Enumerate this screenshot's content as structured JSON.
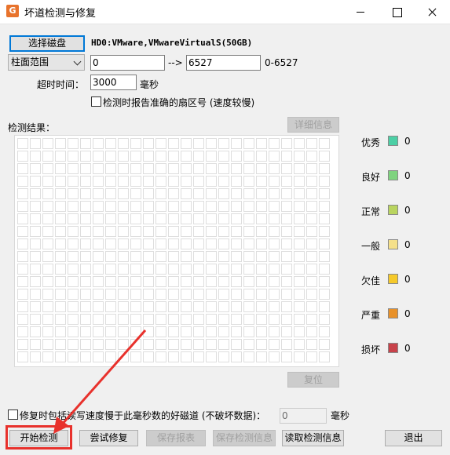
{
  "window": {
    "title": "坏道检测与修复",
    "app_icon_glyph": "G"
  },
  "disk": {
    "select_button": "选择磁盘",
    "name": "HD0:VMware,VMwareVirtualS(50GB)"
  },
  "range": {
    "mode": "柱面范围",
    "start": "0",
    "arrow": "-->",
    "end": "6527",
    "max_label": "0-6527"
  },
  "timeout": {
    "label": "超时时间：",
    "value": "3000",
    "unit": "毫秒"
  },
  "options": {
    "report_exact_sector": "检测时报告准确的扇区号 (速度较慢)",
    "repair_slow_label": "修复时包括读写速度慢于此毫秒数的好磁道 (不破坏数据)：",
    "repair_slow_value": "0",
    "repair_slow_unit": "毫秒"
  },
  "results": {
    "label": "检测结果：",
    "details_button": "详细信息",
    "reset_button": "复位",
    "grid_columns": 25,
    "grid_rows": 18
  },
  "legend": [
    {
      "label": "优秀",
      "color": "#4ccfa5",
      "count": "0"
    },
    {
      "label": "良好",
      "color": "#7ed37e",
      "count": "0"
    },
    {
      "label": "正常",
      "color": "#b9d45f",
      "count": "0"
    },
    {
      "label": "一般",
      "color": "#f5e08a",
      "count": "0"
    },
    {
      "label": "欠佳",
      "color": "#f5c92a",
      "count": "0"
    },
    {
      "label": "严重",
      "color": "#e8912a",
      "count": "0"
    },
    {
      "label": "损坏",
      "color": "#c8424a",
      "count": "0"
    }
  ],
  "actions": {
    "start": "开始检测",
    "try_repair": "尝试修复",
    "save_report": "保存报表",
    "save_info": "保存检测信息",
    "load_info": "读取检测信息",
    "exit": "退出"
  },
  "annotation": {
    "color": "#e8312c"
  }
}
